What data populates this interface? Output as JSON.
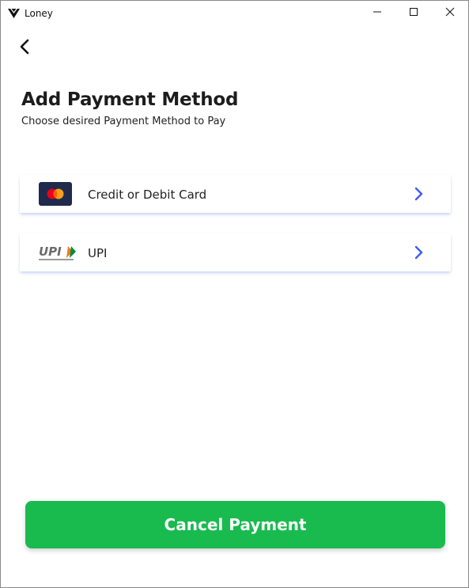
{
  "window": {
    "title": "Loney",
    "app_icon": "loney-logo-icon",
    "controls": [
      "minimize-icon",
      "maximize-icon",
      "close-icon"
    ]
  },
  "nav": {
    "back_icon": "chevron-left-icon"
  },
  "header": {
    "title": "Add Payment Method",
    "subtitle": "Choose desired Payment Method to Pay"
  },
  "payment_methods": [
    {
      "label": "Credit or Debit Card",
      "icon": "card-brand-icon",
      "action_icon": "chevron-right-icon"
    },
    {
      "label": "UPI",
      "icon": "upi-logo-icon",
      "action_icon": "chevron-right-icon"
    }
  ],
  "footer": {
    "cancel_label": "Cancel Payment"
  },
  "colors": {
    "accent_green": "#19bb4f",
    "chevron_blue": "#3d5afe",
    "card_icon_bg": "#1f2a4d"
  }
}
